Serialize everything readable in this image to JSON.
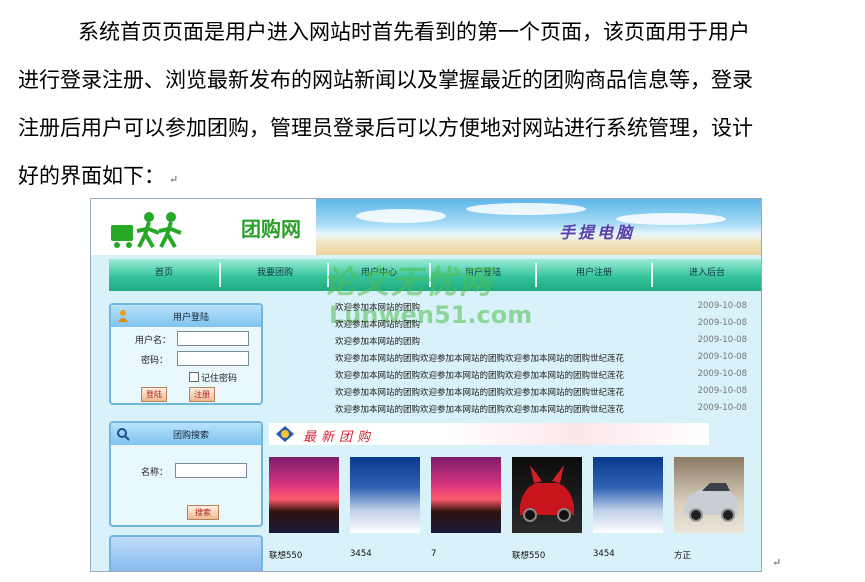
{
  "document": {
    "paragraph_lines": [
      "系统首页页面是用户进入网站时首先看到的第一个页面，该页面用于用户",
      "进行登录注册、浏览最新发布的网站新闻以及掌握最近的团购商品信息等，登录",
      "注册后用户可以参加团购，管理员登录后可以方便地对网站进行系统管理，设计",
      "好的界面如下："
    ],
    "paragraph_mark": "↵",
    "figure_end_mark": "↵"
  },
  "site": {
    "logo_text": "团购网",
    "slogan": "手提电脑",
    "nav": [
      "首页",
      "我要团购",
      "用户中心",
      "用户登陆",
      "用户注册",
      "进入后台"
    ],
    "watermark_line1": "论文无忧网",
    "watermark_line2": "Lunwen51.com",
    "login": {
      "title": "用户登陆",
      "username_label": "用户名：",
      "password_label": "密码：",
      "remember_label": "记住密码",
      "login_button": "登陆",
      "register_button": "注册"
    },
    "search": {
      "title": "团购搜索",
      "name_label": "名称：",
      "search_button": "搜索"
    },
    "news": [
      {
        "title": "欢迎参加本网站的团购",
        "date": "2009-10-08"
      },
      {
        "title": "欢迎参加本网站的团购",
        "date": "2009-10-08"
      },
      {
        "title": "欢迎参加本网站的团购",
        "date": "2009-10-08"
      },
      {
        "title": "欢迎参加本网站的团购欢迎参加本网站的团购欢迎参加本网站的团购世纪莲花",
        "date": "2009-10-08"
      },
      {
        "title": "欢迎参加本网站的团购欢迎参加本网站的团购欢迎参加本网站的团购世纪莲花",
        "date": "2009-10-08"
      },
      {
        "title": "欢迎参加本网站的团购欢迎参加本网站的团购欢迎参加本网站的团购世纪莲花",
        "date": "2009-10-08"
      },
      {
        "title": "欢迎参加本网站的团购欢迎参加本网站的团购欢迎参加本网站的团购世纪莲花",
        "date": "2009-10-08"
      }
    ],
    "section_title": "最新团购",
    "products": [
      {
        "label": "联想550",
        "thumb": "sunset"
      },
      {
        "label": "3454",
        "thumb": "winter"
      },
      {
        "label": "7",
        "thumb": "sunset"
      },
      {
        "label": "联想550",
        "thumb": "red-car"
      },
      {
        "label": "3454",
        "thumb": "winter"
      },
      {
        "label": "方正",
        "thumb": "silver-car"
      }
    ]
  }
}
